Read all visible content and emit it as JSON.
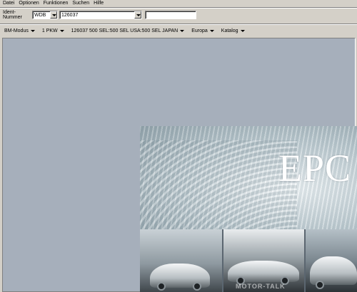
{
  "menu": {
    "items": [
      "Datei",
      "Optionen",
      "Funktionen",
      "Suchen",
      "Hilfe"
    ]
  },
  "ident": {
    "label": "Ident-Nummer",
    "prefix_value": "WDB",
    "number_value": "126037",
    "extra_value": ""
  },
  "toolbar": {
    "items": [
      "BM-Modus",
      "1 PKW",
      "126037 500 SEL:500 SEL USA:500 SEL JAPAN",
      "Europa",
      "Katalog"
    ]
  },
  "splash": {
    "logo_text": "EPC",
    "watermark": "MOTOR-TALK"
  },
  "colors": {
    "window_bg": "#d4d0c8",
    "workspace_bg": "#a6afbb"
  }
}
